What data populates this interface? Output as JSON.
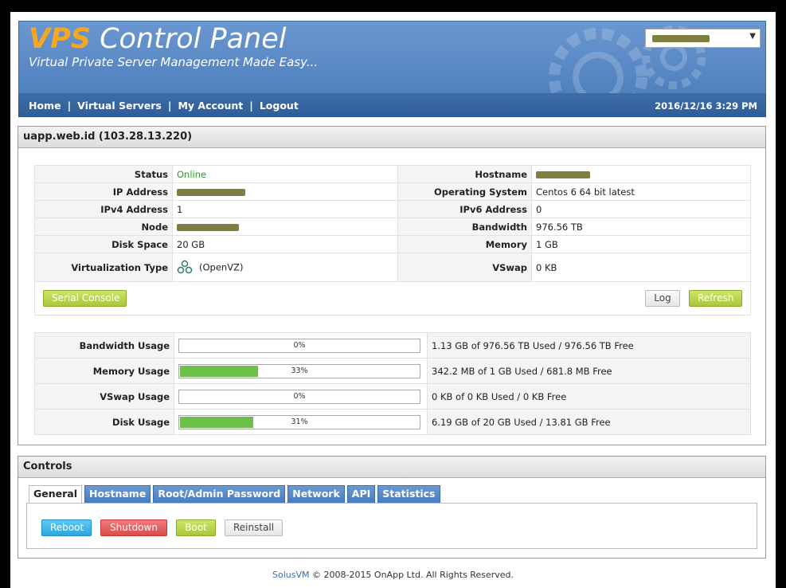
{
  "header": {
    "logo_vps": "VPS",
    "logo_rest": " Control Panel",
    "tagline": "Virtual Private Server Management Made Easy...",
    "server_select_value": ""
  },
  "nav": {
    "links": [
      "Home",
      "Virtual Servers",
      "My Account",
      "Logout"
    ],
    "separator": "|",
    "datetime": "2016/12/16 3:29 PM"
  },
  "server": {
    "title": "uapp.web.id (103.28.13.220)",
    "info": {
      "status_label": "Status",
      "status_value": "Online",
      "hostname_label": "Hostname",
      "hostname_value": "",
      "ip_label": "IP Address",
      "ip_value": "",
      "os_label": "Operating System",
      "os_value": "Centos 6 64 bit latest",
      "ipv4_label": "IPv4 Address",
      "ipv4_value": "1",
      "ipv6_label": "IPv6 Address",
      "ipv6_value": "0",
      "node_label": "Node",
      "node_value": "",
      "bandwidth_label": "Bandwidth",
      "bandwidth_value": "976.56 TB",
      "disk_label": "Disk Space",
      "disk_value": "20 GB",
      "memory_label": "Memory",
      "memory_value": "1 GB",
      "virt_label": "Virtualization Type",
      "virt_value": "(OpenVZ)",
      "vswap_label": "VSwap",
      "vswap_value": "0 KB"
    },
    "buttons": {
      "serial_console": "Serial Console",
      "log": "Log",
      "refresh": "Refresh"
    },
    "usage": [
      {
        "label": "Bandwidth Usage",
        "percent": 0,
        "percent_text": "0%",
        "detail": "1.13 GB of 976.56 TB Used / 976.56 TB Free"
      },
      {
        "label": "Memory Usage",
        "percent": 33,
        "percent_text": "33%",
        "detail": "342.2 MB of 1 GB Used / 681.8 MB Free"
      },
      {
        "label": "VSwap Usage",
        "percent": 0,
        "percent_text": "0%",
        "detail": "0 KB of 0 KB Used / 0 KB Free"
      },
      {
        "label": "Disk Usage",
        "percent": 31,
        "percent_text": "31%",
        "detail": "6.19 GB of 20 GB Used / 13.81 GB Free"
      }
    ]
  },
  "controls": {
    "title": "Controls",
    "tabs": [
      "General",
      "Hostname",
      "Root/Admin Password",
      "Network",
      "API",
      "Statistics"
    ],
    "active_tab": "General",
    "actions": {
      "reboot": "Reboot",
      "shutdown": "Shutdown",
      "boot": "Boot",
      "reinstall": "Reinstall"
    }
  },
  "footer": {
    "brand": "SolusVM",
    "text": " © 2008-2015 OnApp Ltd. All Rights Reserved."
  },
  "colors": {
    "banner_blue": "#5a8ac8",
    "nav_blue": "#3466a3",
    "online_green": "#2d9a2d",
    "progress_green": "#6cc04a",
    "accent_orange": "#f5a623"
  }
}
